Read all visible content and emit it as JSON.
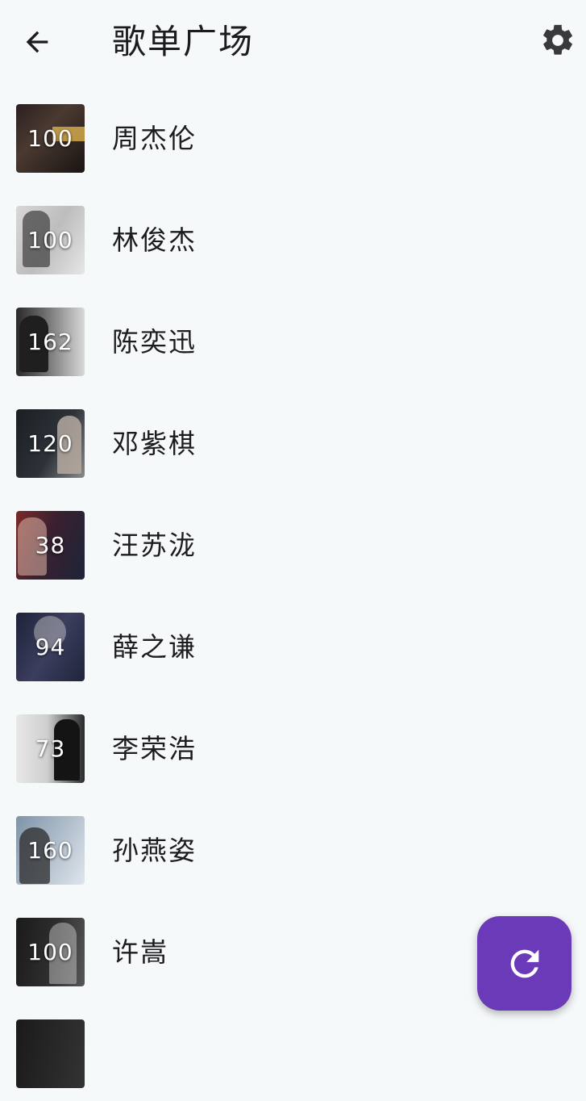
{
  "app_bar": {
    "title": "歌单广场",
    "back_icon": "arrow-left-icon",
    "settings_icon": "gear-icon"
  },
  "playlists": [
    {
      "name": "周杰伦",
      "count": "100"
    },
    {
      "name": "林俊杰",
      "count": "100"
    },
    {
      "name": "陈奕迅",
      "count": "162"
    },
    {
      "name": "邓紫棋",
      "count": "120"
    },
    {
      "name": "汪苏泷",
      "count": "38"
    },
    {
      "name": "薛之谦",
      "count": "94"
    },
    {
      "name": "李荣浩",
      "count": "73"
    },
    {
      "name": "孙燕姿",
      "count": "160"
    },
    {
      "name": "许嵩",
      "count": "100"
    }
  ],
  "fab": {
    "icon": "refresh-icon",
    "color": "#6b3ab8"
  },
  "colors": {
    "background": "#f5f9fa",
    "accent": "#6b3ab8"
  }
}
